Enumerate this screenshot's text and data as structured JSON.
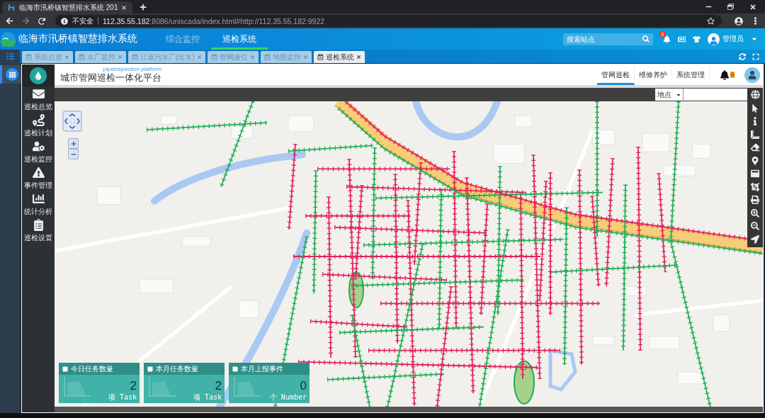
{
  "browser": {
    "tab_title": "临海市汛桥镇智慧排水系统 201",
    "security": "不安全",
    "url": {
      "host": "112.35.55.182",
      "path": ":8086/uniscada/index.html#http://112.35.55.182:9922"
    }
  },
  "app_header": {
    "title": "临海市汛桥镇智慧排水系统",
    "nav": [
      {
        "label": "综合监控",
        "selected": false
      },
      {
        "label": "巡检系统",
        "selected": true
      }
    ],
    "search": {
      "placeholder": "搜索站点"
    },
    "notification_count": "0",
    "user": "管理员"
  },
  "tabs": [
    {
      "label": "系统总览",
      "selected": false
    },
    {
      "label": "水厂监控",
      "selected": false
    },
    {
      "label": "江厦污水厂(出水)",
      "selected": false
    },
    {
      "label": "管网液位",
      "selected": false
    },
    {
      "label": "地图监控",
      "selected": false
    },
    {
      "label": "巡检系统",
      "selected": true
    }
  ],
  "sidebar": {
    "items": [
      {
        "selected": true
      }
    ]
  },
  "platform": {
    "subtitle": "pipeinspection platform",
    "title": "城市管网巡检一体化平台",
    "nav": [
      {
        "label": "管网巡检",
        "selected": true
      },
      {
        "label": "维修养护",
        "selected": false
      },
      {
        "label": "系统管理",
        "selected": false
      }
    ],
    "alert_count": "0"
  },
  "side_menu": [
    {
      "label": "巡检总览"
    },
    {
      "label": "巡检计划"
    },
    {
      "label": "巡检监控"
    },
    {
      "label": "事件管理"
    },
    {
      "label": "统计分析"
    },
    {
      "label": "巡检设置"
    }
  ],
  "map": {
    "place_select": "地点",
    "stats": [
      {
        "title": "今日任务数量",
        "value": "2",
        "unit": "项 Task"
      },
      {
        "title": "本月任务数量",
        "value": "2",
        "unit": "项 Task"
      },
      {
        "title": "本月上报事件",
        "value": "0",
        "unit": "个 Number"
      }
    ]
  }
}
